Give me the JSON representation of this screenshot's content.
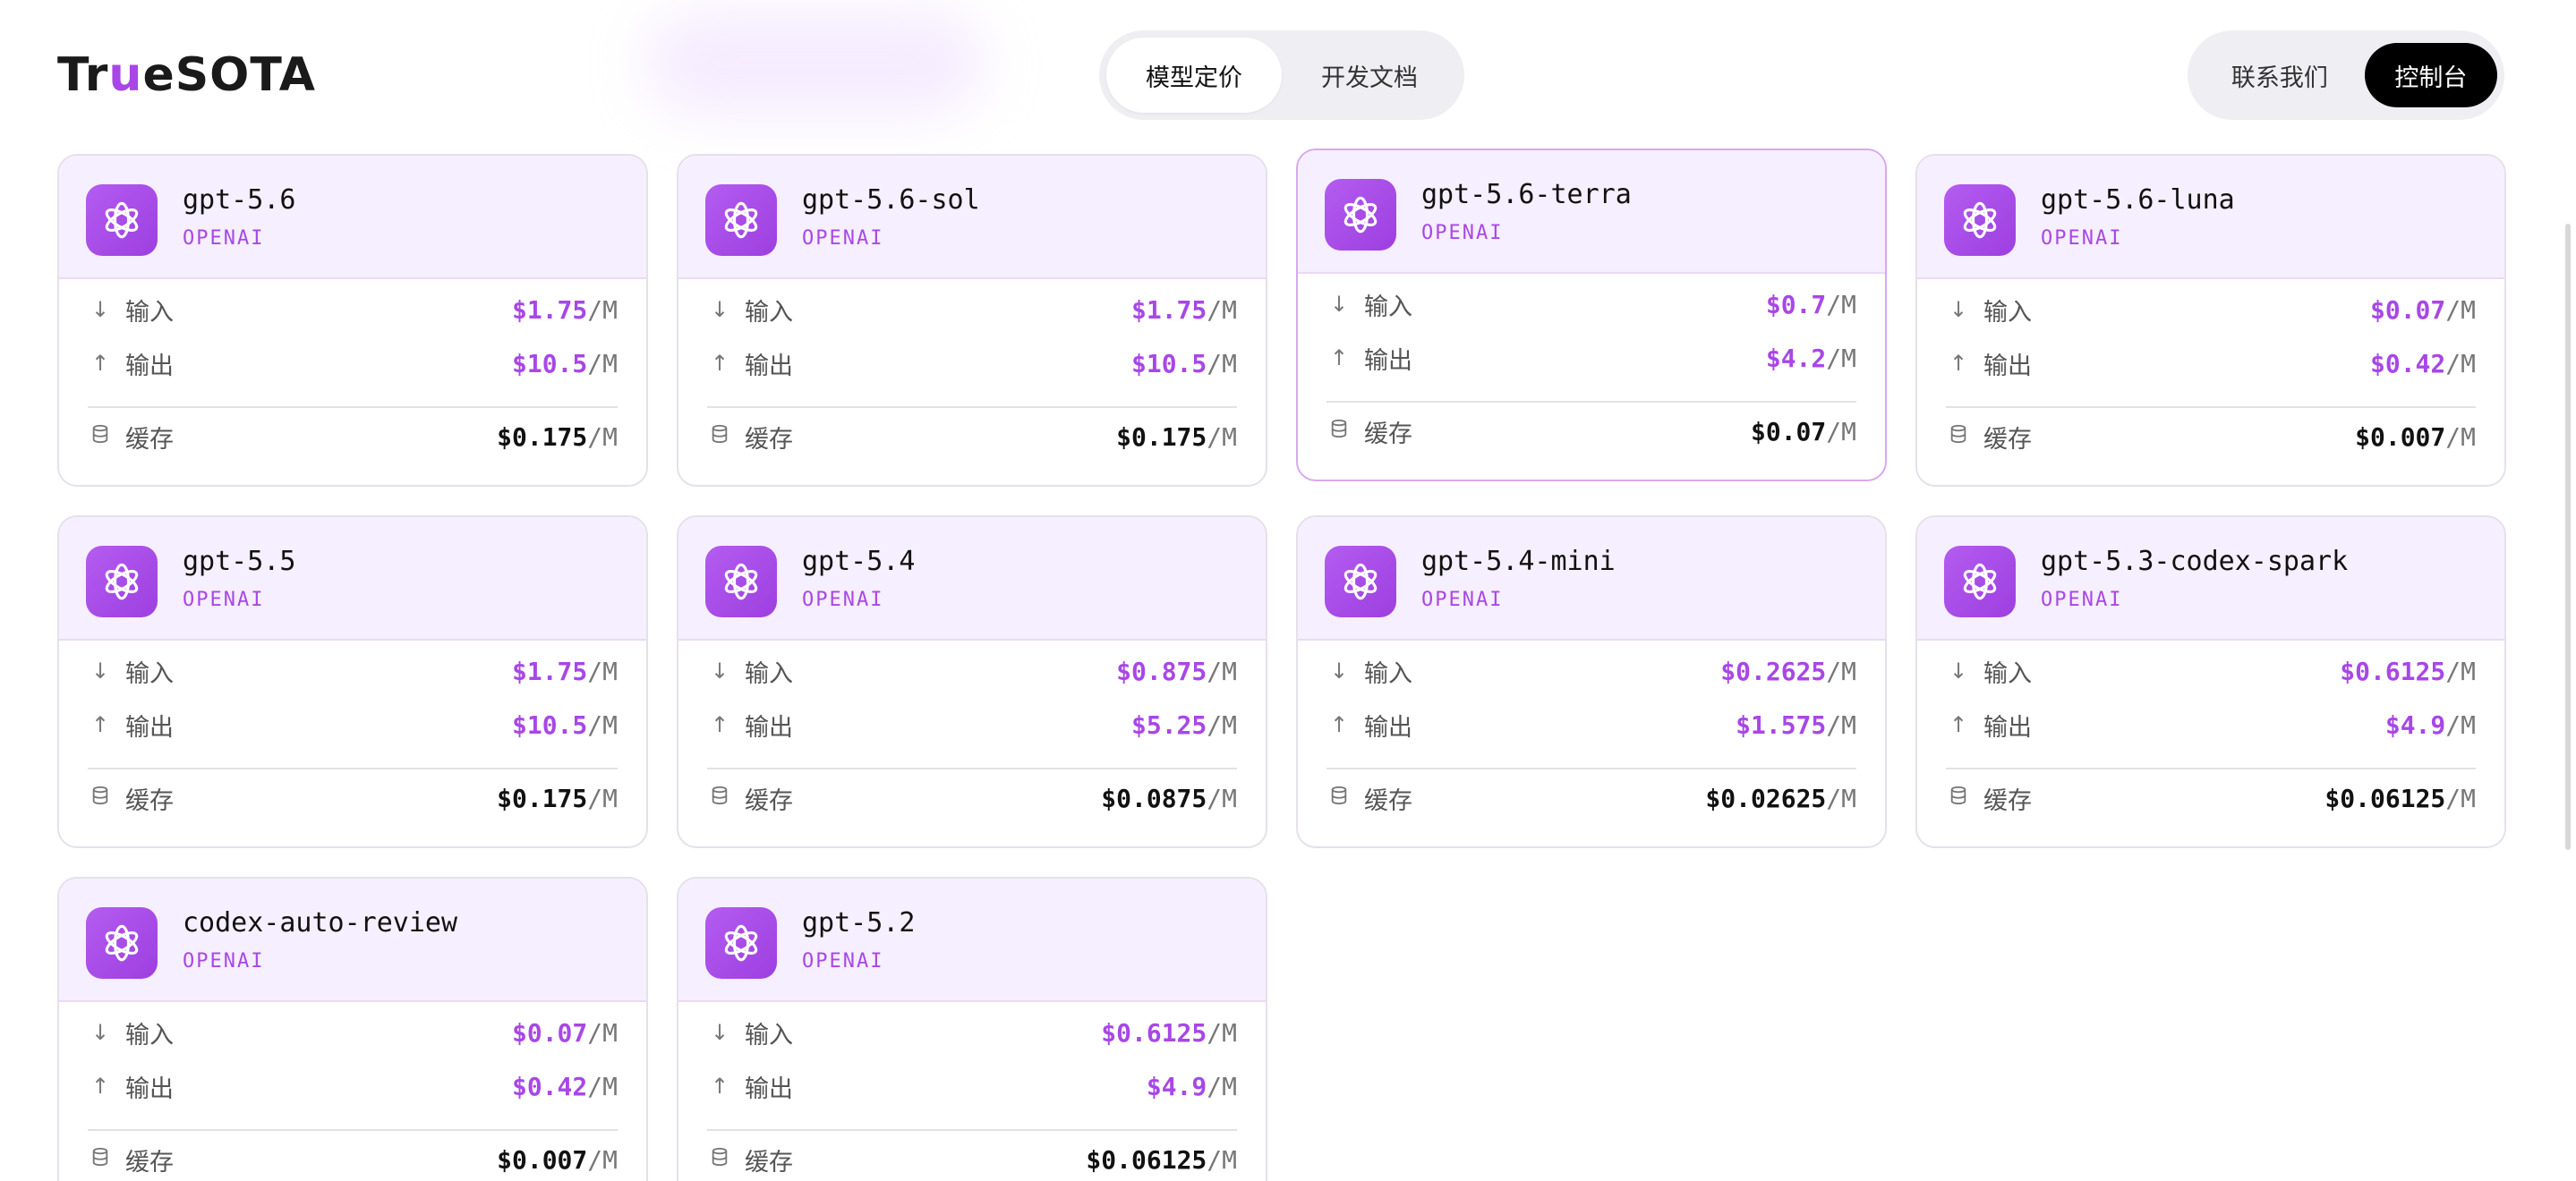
{
  "brand": {
    "logo_prefix": "Tr",
    "logo_highlight": "u",
    "logo_suffix": "eSOTA",
    "accent": "#a847e6"
  },
  "nav": {
    "tabs": [
      {
        "label": "模型定价",
        "active": true
      },
      {
        "label": "开发文档",
        "active": false
      }
    ]
  },
  "actions": {
    "contact_label": "联系我们",
    "console_label": "控制台"
  },
  "labels": {
    "input": "输入",
    "output": "输出",
    "cache": "缓存",
    "unit": "/M"
  },
  "cards": [
    {
      "name": "gpt-5.6",
      "provider": "OPENAI",
      "input": "$1.75",
      "output": "$10.5",
      "cache": "$0.175"
    },
    {
      "name": "gpt-5.6-sol",
      "provider": "OPENAI",
      "input": "$1.75",
      "output": "$10.5",
      "cache": "$0.175"
    },
    {
      "name": "gpt-5.6-terra",
      "provider": "OPENAI",
      "input": "$0.7",
      "output": "$4.2",
      "cache": "$0.07"
    },
    {
      "name": "gpt-5.6-luna",
      "provider": "OPENAI",
      "input": "$0.07",
      "output": "$0.42",
      "cache": "$0.007"
    },
    {
      "name": "gpt-5.5",
      "provider": "OPENAI",
      "input": "$1.75",
      "output": "$10.5",
      "cache": "$0.175"
    },
    {
      "name": "gpt-5.4",
      "provider": "OPENAI",
      "input": "$0.875",
      "output": "$5.25",
      "cache": "$0.0875"
    },
    {
      "name": "gpt-5.4-mini",
      "provider": "OPENAI",
      "input": "$0.2625",
      "output": "$1.575",
      "cache": "$0.02625"
    },
    {
      "name": "gpt-5.3-codex-spark",
      "provider": "OPENAI",
      "input": "$0.6125",
      "output": "$4.9",
      "cache": "$0.06125"
    },
    {
      "name": "codex-auto-review",
      "provider": "OPENAI",
      "input": "$0.07",
      "output": "$0.42",
      "cache": "$0.007"
    },
    {
      "name": "gpt-5.2",
      "provider": "OPENAI",
      "input": "$0.6125",
      "output": "$4.9",
      "cache": "$0.06125"
    }
  ],
  "icons": {
    "model": "openai-icon",
    "input": "arrow-down-icon",
    "output": "arrow-up-icon",
    "cache": "database-icon"
  }
}
